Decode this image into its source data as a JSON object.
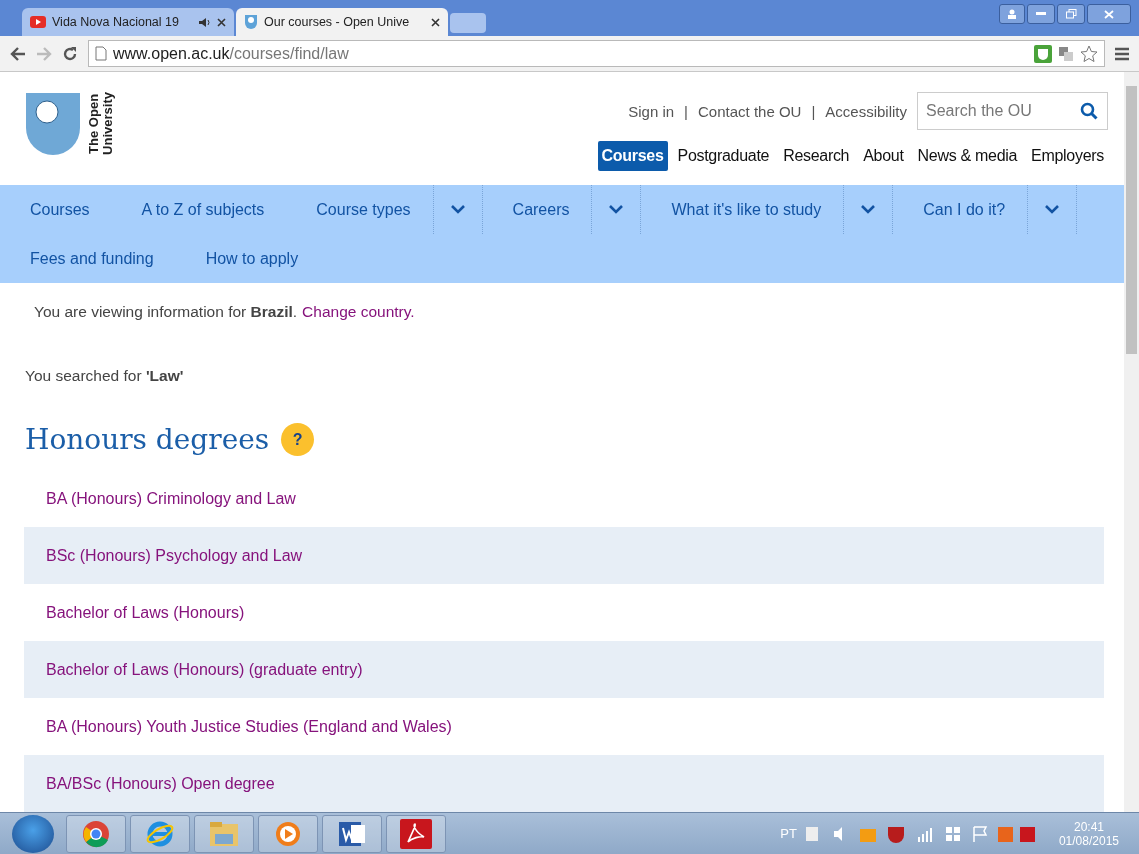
{
  "browser": {
    "tabs": [
      {
        "title": "Vida Nova Nacional 19",
        "kind": "video",
        "audio": true,
        "selected": false
      },
      {
        "title": "Our courses - Open Unive",
        "kind": "site",
        "audio": false,
        "selected": true
      }
    ],
    "url_host": "www.open.ac.uk",
    "url_path": "/courses/find/law"
  },
  "header": {
    "logo_lines": [
      "The Open",
      "University"
    ],
    "utility_links": [
      "Sign in",
      "Contact the OU",
      "Accessibility"
    ],
    "utility_separator": "|",
    "search": {
      "placeholder": "Search the OU"
    },
    "main_nav": [
      {
        "label": "Courses",
        "selected": true
      },
      {
        "label": "Postgraduate",
        "selected": false
      },
      {
        "label": "Research",
        "selected": false
      },
      {
        "label": "About",
        "selected": false
      },
      {
        "label": "News & media",
        "selected": false
      },
      {
        "label": "Employers",
        "selected": false
      }
    ]
  },
  "sub_nav": [
    [
      {
        "label": "Courses",
        "dropdown": false
      },
      {
        "label": "A to Z of subjects",
        "dropdown": false
      },
      {
        "label": "Course types",
        "dropdown": true
      },
      {
        "label": "Careers",
        "dropdown": true
      },
      {
        "label": "What it's like to study",
        "dropdown": true
      },
      {
        "label": "Can I do it?",
        "dropdown": true
      }
    ],
    [
      {
        "label": "Fees and funding",
        "dropdown": false
      },
      {
        "label": "How to apply",
        "dropdown": false
      }
    ]
  ],
  "country_notice": {
    "text": "You are viewing information for **Brazil**.",
    "link": "Change country."
  },
  "search_summary": "You searched for **'Law'**",
  "section": {
    "title": "Honours degrees",
    "help": "?",
    "courses": [
      "BA (Honours) Criminology and Law",
      "BSc (Honours) Psychology and Law",
      "Bachelor of Laws (Honours)",
      "Bachelor of Laws (Honours) (graduate entry)",
      "BA (Honours) Youth Justice Studies (England and Wales)",
      "BA/BSc (Honours) Open degree"
    ]
  },
  "taskbar": {
    "apps": [
      {
        "kind": "chrome"
      },
      {
        "kind": "ie"
      },
      {
        "kind": "folder"
      },
      {
        "kind": "media"
      },
      {
        "kind": "word"
      },
      {
        "kind": "pdf"
      }
    ],
    "language": "PT",
    "time": "20:41",
    "date": "01/08/2015"
  }
}
